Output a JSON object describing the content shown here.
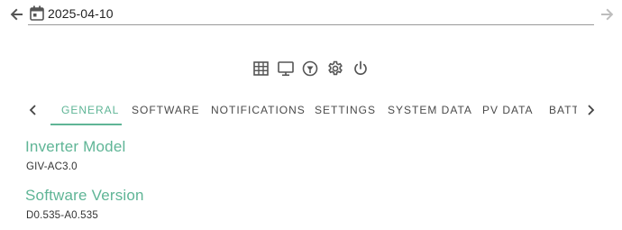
{
  "header": {
    "date_value": "2025-04-10",
    "back_icon": "arrow-left-icon",
    "forward_icon": "arrow-right-icon",
    "calendar_icon": "calendar-icon"
  },
  "toolbar": {
    "icons": [
      "grid-icon",
      "monitor-icon",
      "gauge-icon",
      "gear-icon",
      "power-icon"
    ]
  },
  "tabs": {
    "items": [
      {
        "label": "General"
      },
      {
        "label": "Software"
      },
      {
        "label": "Notifications"
      },
      {
        "label": "Settings"
      },
      {
        "label": "System Data"
      },
      {
        "label": "PV Data"
      },
      {
        "label": "Battery"
      }
    ],
    "active_index": 0
  },
  "general": {
    "inverter_model_title": "Inverter Model",
    "inverter_model_value": "GIV-AC3.0",
    "software_version_title": "Software Version",
    "software_version_value": "D0.535-A0.535"
  },
  "colors": {
    "accent": "#5fb596",
    "text": "#333333",
    "icon": "#555555",
    "disabled": "#bdbdbd"
  }
}
